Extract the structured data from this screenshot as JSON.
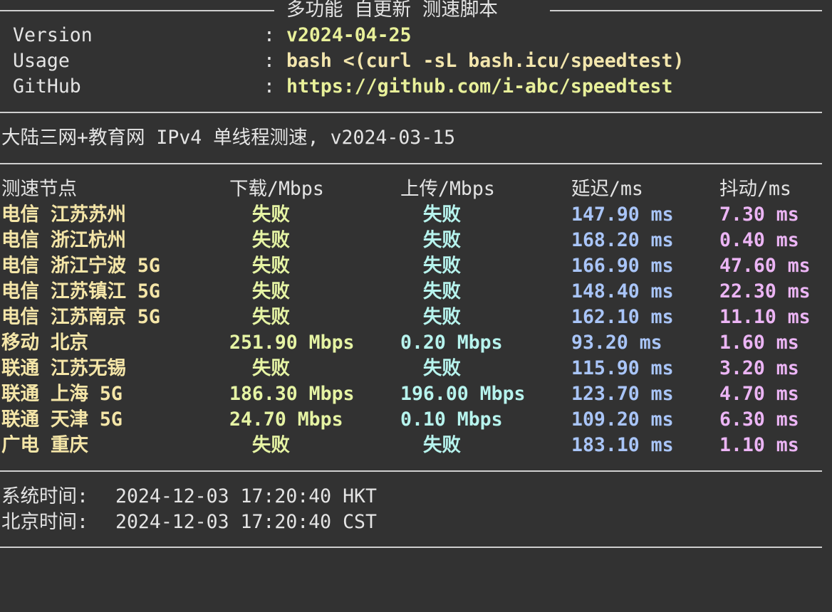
{
  "header": {
    "title": "多功能 自更新 测速脚本"
  },
  "info": [
    {
      "label": "Version",
      "sep": ":",
      "value": "v2024-04-25",
      "color": "#e8f09a"
    },
    {
      "label": "Usage",
      "sep": ":",
      "value": "bash <(curl -sL bash.icu/speedtest)",
      "color": "#f3e6ad"
    },
    {
      "label": "GitHub",
      "sep": ":",
      "value": "https://github.com/i-abc/speedtest",
      "color": "#e8f09a"
    }
  ],
  "subtitle": "大陆三网+教育网 IPv4 单线程测速, v2024-03-15",
  "table": {
    "headers": [
      "测速节点",
      "下载/Mbps",
      "上传/Mbps",
      "延迟/ms",
      "抖动/ms"
    ],
    "rows": [
      {
        "node": "电信 江苏苏州",
        "download": "  失败",
        "upload": "  失败",
        "latency": "147.90 ms",
        "jitter": "7.30 ms"
      },
      {
        "node": "电信 浙江杭州",
        "download": "  失败",
        "upload": "  失败",
        "latency": "168.20 ms",
        "jitter": "0.40 ms"
      },
      {
        "node": "电信 浙江宁波 5G",
        "download": "  失败",
        "upload": "  失败",
        "latency": "166.90 ms",
        "jitter": "47.60 ms"
      },
      {
        "node": "电信 江苏镇江 5G",
        "download": "  失败",
        "upload": "  失败",
        "latency": "148.40 ms",
        "jitter": "22.30 ms"
      },
      {
        "node": "电信 江苏南京 5G",
        "download": "  失败",
        "upload": "  失败",
        "latency": "162.10 ms",
        "jitter": "11.10 ms"
      },
      {
        "node": "移动 北京",
        "download": "251.90 Mbps",
        "upload": "0.20 Mbps",
        "latency": "93.20 ms",
        "jitter": "1.60 ms"
      },
      {
        "node": "联通 江苏无锡",
        "download": "  失败",
        "upload": "  失败",
        "latency": "115.90 ms",
        "jitter": "3.20 ms"
      },
      {
        "node": "联通 上海 5G",
        "download": "186.30 Mbps",
        "upload": "196.00 Mbps",
        "latency": "123.70 ms",
        "jitter": "4.70 ms"
      },
      {
        "node": "联通 天津 5G",
        "download": "24.70 Mbps",
        "upload": "0.10 Mbps",
        "latency": "109.20 ms",
        "jitter": "6.30 ms"
      },
      {
        "node": "广电 重庆",
        "download": "  失败",
        "upload": "  失败",
        "latency": "183.10 ms",
        "jitter": "1.10 ms"
      }
    ]
  },
  "footer": [
    {
      "label": "系统时间:",
      "value": "2024-12-03 17:20:40 HKT"
    },
    {
      "label": "北京时间:",
      "value": "2024-12-03 17:20:40 CST"
    }
  ],
  "colors": {
    "background": "#323232",
    "node": "#f5e6a8",
    "download": "#e6f4a4",
    "upload": "#b7f4ee",
    "latency": "#a9c5f8",
    "jitter": "#ecb5f5"
  }
}
